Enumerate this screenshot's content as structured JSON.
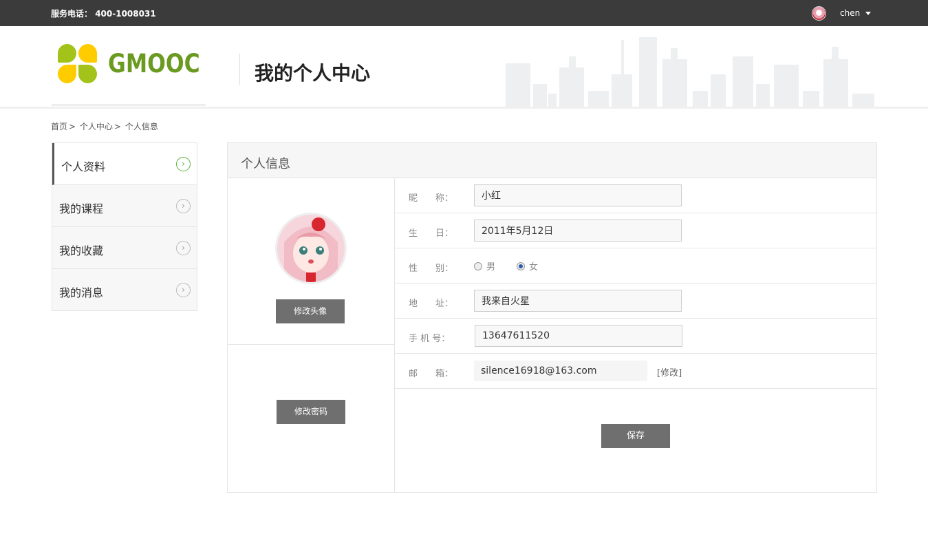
{
  "topbar": {
    "service_label": "服务电话：",
    "service_phone": "400-1008031",
    "username": "chen"
  },
  "header": {
    "logo_text": "GMOOC",
    "page_title": "我的个人中心"
  },
  "breadcrumb": [
    "首页",
    ">",
    "个人中心",
    ">",
    "个人信息"
  ],
  "sidebar": {
    "items": [
      {
        "label": "个人资料",
        "active": true
      },
      {
        "label": "我的课程",
        "active": false
      },
      {
        "label": "我的收藏",
        "active": false
      },
      {
        "label": "我的消息",
        "active": false
      }
    ],
    "arrow_glyph": "›"
  },
  "panel": {
    "title": "个人信息",
    "change_avatar_label": "修改头像",
    "change_password_label": "修改密码",
    "fields": {
      "nickname": {
        "label": "昵　　称：",
        "value": "小红"
      },
      "birthday": {
        "label": "生　　日：",
        "value": "2011年5月12日"
      },
      "gender": {
        "label": "性　　别：",
        "options": [
          "男",
          "女"
        ],
        "selected": "女"
      },
      "address": {
        "label": "地　　址：",
        "value": "我来自火星"
      },
      "phone": {
        "label": "手 机 号：",
        "value": "13647611520"
      },
      "email": {
        "label": "邮　　箱：",
        "value": "silence16918@163.com",
        "edit_label": "[修改]"
      }
    },
    "save_label": "保存"
  },
  "colors": {
    "topbar_bg": "#3b3b3b",
    "logo_green": "#6a9a1f",
    "logo_yellow": "#ffcc00",
    "button_gray": "#6f6f6f",
    "active_arrow": "#5ab33b"
  }
}
